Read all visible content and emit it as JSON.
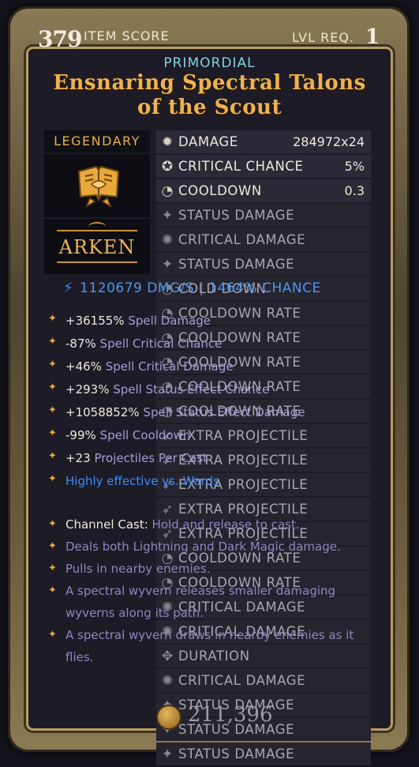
{
  "header": {
    "item_score": "379",
    "item_score_label": "ITEM SCORE",
    "lvl_label": "LVL REQ.",
    "lvl_value": "1"
  },
  "item": {
    "tier": "PRIMORDIAL",
    "name": "Ensnaring Spectral Talons of the Scout",
    "rarity": "LEGENDARY",
    "brand": "ARKEN"
  },
  "stats": [
    {
      "name": "DAMAGE",
      "value": "284972x24",
      "icon": "damage-icon",
      "active": true
    },
    {
      "name": "CRITICAL CHANCE",
      "value": "5%",
      "icon": "crit-chance-icon",
      "active": true
    },
    {
      "name": "COOLDOWN",
      "value": "0.3",
      "icon": "cooldown-icon",
      "active": true
    },
    {
      "name": "STATUS DAMAGE",
      "value": "",
      "icon": "status-icon",
      "active": false
    },
    {
      "name": "CRITICAL DAMAGE",
      "value": "",
      "icon": "crit-damage-icon",
      "active": false
    },
    {
      "name": "STATUS DAMAGE",
      "value": "",
      "icon": "status-icon",
      "active": false
    },
    {
      "name": "COLD DOWN",
      "value": "",
      "icon": "cooldown-icon",
      "active": false
    },
    {
      "name": "COOLDOWN RATE",
      "value": "",
      "icon": "cooldown-icon",
      "active": false
    },
    {
      "name": "COOLDOWN RATE",
      "value": "",
      "icon": "cooldown-icon",
      "active": false
    },
    {
      "name": "COOLDOWN RATE",
      "value": "",
      "icon": "cooldown-icon",
      "active": false
    },
    {
      "name": "COOLDOWN RATE",
      "value": "",
      "icon": "cooldown-icon",
      "active": false
    },
    {
      "name": "COOLDOWN RATE",
      "value": "",
      "icon": "cooldown-icon",
      "active": false
    },
    {
      "name": "EXTRA PROJECTILE",
      "value": "",
      "icon": "projectile-icon",
      "active": false
    },
    {
      "name": "EXTRA PROJECTILE",
      "value": "",
      "icon": "projectile-icon",
      "active": false
    },
    {
      "name": "EXTRA PROJECTILE",
      "value": "",
      "icon": "projectile-icon",
      "active": false
    },
    {
      "name": "EXTRA PROJECTILE",
      "value": "",
      "icon": "projectile-icon",
      "active": false
    },
    {
      "name": "EXTRA PROJECTILE",
      "value": "",
      "icon": "projectile-icon",
      "active": false
    },
    {
      "name": "COOLDOWN RATE",
      "value": "",
      "icon": "cooldown-icon",
      "active": false
    },
    {
      "name": "COOLDOWN RATE",
      "value": "",
      "icon": "cooldown-icon",
      "active": false
    },
    {
      "name": "CRITICAL DAMAGE",
      "value": "",
      "icon": "crit-damage-icon",
      "active": false
    },
    {
      "name": "CRITICAL DAMAGE",
      "value": "",
      "icon": "crit-damage-icon",
      "active": false
    },
    {
      "name": "DURATION",
      "value": "",
      "icon": "duration-icon",
      "active": false
    },
    {
      "name": "CRITICAL DAMAGE",
      "value": "",
      "icon": "crit-damage-icon",
      "active": false
    },
    {
      "name": "STATUS DAMAGE",
      "value": "",
      "icon": "status-icon",
      "active": false
    },
    {
      "name": "STATUS DAMAGE",
      "value": "",
      "icon": "status-icon",
      "active": false
    },
    {
      "name": "STATUS DAMAGE",
      "value": "",
      "icon": "status-icon",
      "active": false
    }
  ],
  "dps": {
    "dmg": "1120679 DMG/S",
    "sep": "|",
    "chance": "1464% CHANCE"
  },
  "affixes": [
    {
      "value": "+36155%",
      "desc": "Spell Damage"
    },
    {
      "value": "-87%",
      "desc": "Spell Critical Chance"
    },
    {
      "value": "+46%",
      "desc": "Spell Critical Damage"
    },
    {
      "value": "+293%",
      "desc": "Spell Status Effect Chance"
    },
    {
      "value": "+1058852%",
      "desc": "Spell Status Effect Damage"
    },
    {
      "value": "-99%",
      "desc": "Spell Cooldown"
    },
    {
      "value": "+23",
      "desc": "Projectiles Per Cast"
    },
    {
      "value": "Highly effective vs. Wards",
      "desc": "",
      "blue": true
    }
  ],
  "passives": [
    {
      "head": "Channel Cast:",
      "text": "Hold and release to cast."
    },
    {
      "head": "",
      "text": "Deals both Lightning and Dark Magic damage."
    },
    {
      "head": "",
      "text": "Pulls in nearby enemies."
    },
    {
      "head": "",
      "text": "A spectral wyvern releases smaller damaging wyverns along its path."
    },
    {
      "head": "",
      "text": "A spectral wyvern draws in nearby enemies as it flies."
    }
  ],
  "footer": {
    "gold": "211,396"
  },
  "colors": {
    "title": "#f0b24f",
    "tier": "#7fd3de",
    "dps": "#4e96f0",
    "affix_desc": "#a99ad8",
    "frame": "#b89c62"
  }
}
